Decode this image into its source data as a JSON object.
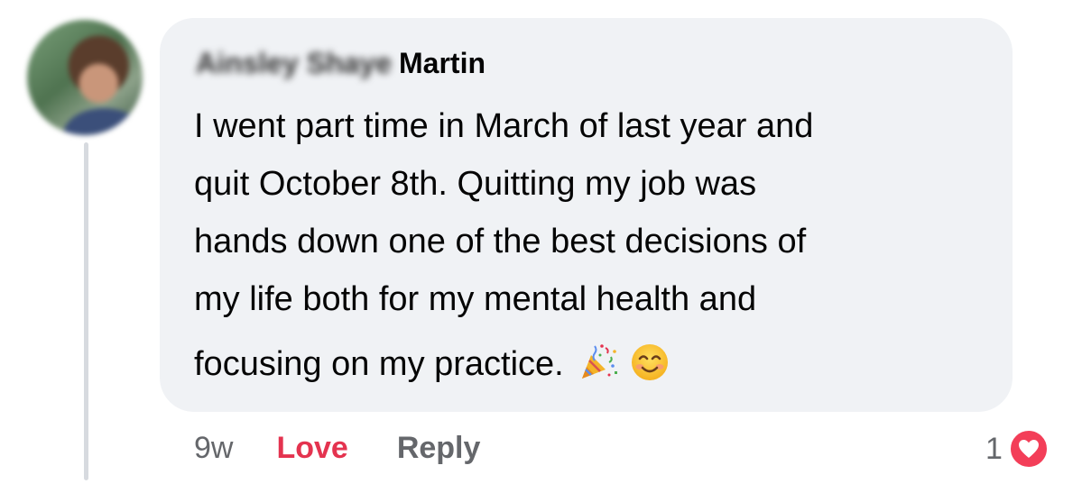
{
  "comment": {
    "author": {
      "name_blurred": "Ainsley Shaye",
      "name_last": "Martin",
      "avatar_icon": "profile-photo"
    },
    "lines": [
      "I went part time in March of last year and",
      "quit October 8th. Quitting my job was",
      "hands down one of the best decisions of",
      "my life both for my mental health and",
      "focusing on my practice."
    ],
    "emojis": [
      "party-popper-icon",
      "smiling-face-icon"
    ],
    "timestamp": "9w",
    "actions": {
      "love_label": "Love",
      "reply_label": "Reply"
    },
    "reactions": {
      "count": "1",
      "type": "heart-icon"
    }
  },
  "colors": {
    "bubble_bg": "#f0f2f5",
    "love": "#e4334f",
    "muted": "#65676b",
    "heart_badge": "#f33e58"
  }
}
